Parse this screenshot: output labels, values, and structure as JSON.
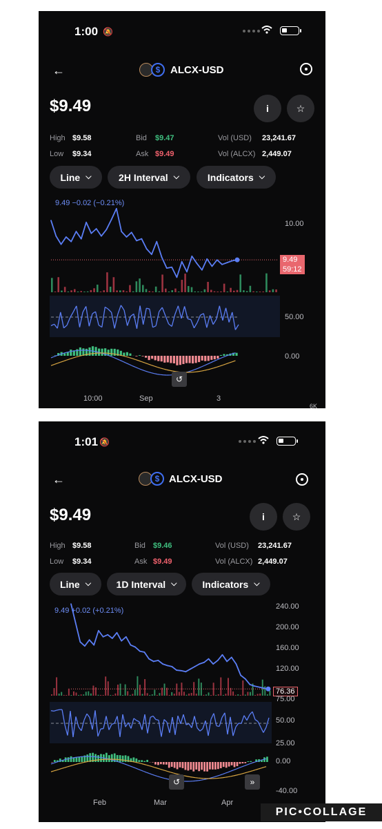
{
  "screens": [
    {
      "status": {
        "time": "1:00"
      },
      "header": {
        "pair": "ALCX-USD"
      },
      "price": "$9.49",
      "stats": {
        "high_label": "High",
        "high": "$9.58",
        "low_label": "Low",
        "low": "$9.34",
        "bid_label": "Bid",
        "bid": "$9.47",
        "ask_label": "Ask",
        "ask": "$9.49",
        "vol_usd_label": "Vol (USD)",
        "vol_usd": "23,241.67",
        "vol_alcx_label": "Vol (ALCX)",
        "vol_alcx": "2,449.07"
      },
      "controls": {
        "type": "Line",
        "interval": "2H Interval",
        "indicators": "Indicators"
      },
      "chart": {
        "headline": "9.49 −0.02 (−0.21%)",
        "y_labels": [
          "10.00"
        ],
        "price_tag": [
          "9.49",
          "59:12"
        ],
        "rsi_label": "50.00",
        "macd_label": "0.00",
        "x_labels": [
          "10:00",
          "Sep",
          "3"
        ],
        "corner": "6K"
      }
    },
    {
      "status": {
        "time": "1:01"
      },
      "header": {
        "pair": "ALCX-USD"
      },
      "price": "$9.49",
      "stats": {
        "high_label": "High",
        "high": "$9.58",
        "low_label": "Low",
        "low": "$9.34",
        "bid_label": "Bid",
        "bid": "$9.46",
        "ask_label": "Ask",
        "ask": "$9.49",
        "vol_usd_label": "Vol (USD)",
        "vol_usd": "23,241.67",
        "vol_alcx_label": "Vol (ALCX)",
        "vol_alcx": "2,449.07"
      },
      "controls": {
        "type": "Line",
        "interval": "1D Interval",
        "indicators": "Indicators"
      },
      "chart": {
        "headline": "9.49 +0.02 (+0.21%)",
        "y_labels": [
          "240.00",
          "200.00",
          "160.00",
          "120.00",
          "75.00"
        ],
        "price_tag": [
          "76.36"
        ],
        "rsi_labels": [
          "50.00",
          "25.00"
        ],
        "macd_labels": [
          "0.00",
          "-40.00"
        ],
        "x_labels": [
          "Feb",
          "Mar",
          "Apr"
        ]
      }
    }
  ],
  "watermark": "PIC•COLLAGE",
  "colors": {
    "line": "#5b7ef5",
    "up": "#3fbf7f",
    "down": "#f0616d",
    "macd_signal": "#d9a642"
  },
  "chart_data": [
    {
      "type": "line",
      "title": "",
      "series": [
        {
          "values": [
            9.92,
            9.75,
            9.66,
            9.74,
            9.69,
            9.8,
            9.72,
            9.9,
            9.78,
            9.83,
            9.75,
            9.82,
            9.93,
            10.05,
            9.8,
            9.74,
            9.79,
            9.7,
            9.72,
            9.61,
            9.55,
            9.69,
            9.52,
            9.4,
            9.41,
            9.3,
            9.47,
            9.36,
            9.53,
            9.45,
            9.38,
            9.5,
            9.42,
            9.49,
            9.44,
            9.46,
            9.48,
            9.49
          ]
        }
      ],
      "y_ticks": [
        10.0
      ],
      "x_labels": [
        "10:00",
        "Sep",
        "3"
      ]
    },
    {
      "type": "line",
      "title": "",
      "series": [
        {
          "values": [
            242,
            205,
            168,
            160,
            172,
            162,
            190,
            178,
            182,
            175,
            186,
            170,
            178,
            162,
            158,
            150,
            148,
            135,
            130,
            132,
            125,
            122,
            120,
            113,
            112,
            110,
            115,
            120,
            125,
            128,
            135,
            125,
            132,
            143,
            130,
            138,
            125,
            103,
            96,
            85,
            82,
            80,
            78,
            76.36
          ]
        }
      ],
      "y_ticks": [
        240,
        200,
        160,
        120,
        75
      ],
      "x_labels": [
        "Feb",
        "Mar",
        "Apr"
      ]
    }
  ]
}
